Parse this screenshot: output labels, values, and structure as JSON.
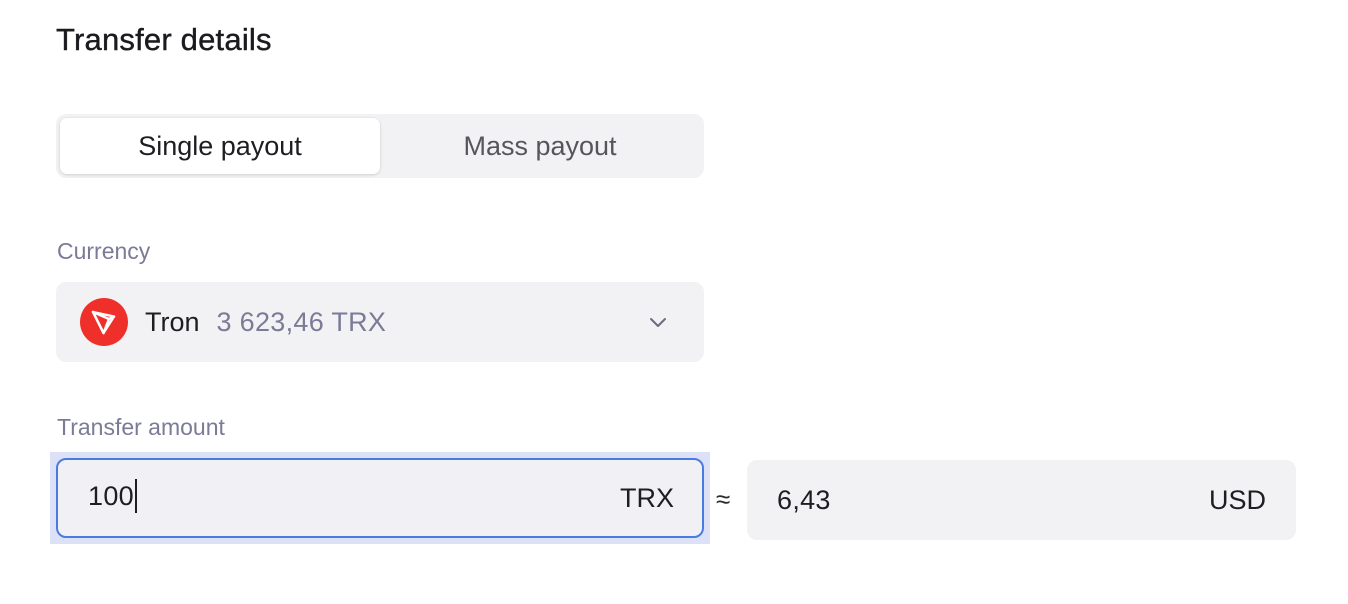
{
  "page": {
    "title": "Transfer details"
  },
  "payout_tabs": [
    {
      "label": "Single payout",
      "active": true
    },
    {
      "label": "Mass payout",
      "active": false
    }
  ],
  "currency": {
    "label": "Currency",
    "selected": {
      "name": "Tron",
      "balance": "3 623,46 TRX",
      "icon": "tron-logo-icon",
      "icon_color": "#ef2f2a"
    },
    "dropdown_icon": "chevron-down-icon"
  },
  "transfer": {
    "label": "Transfer amount",
    "amount": "100",
    "amount_unit": "TRX",
    "approx_symbol": "≈",
    "converted_amount": "6,43",
    "converted_unit": "USD",
    "focus_color": "#4a7ce0"
  }
}
